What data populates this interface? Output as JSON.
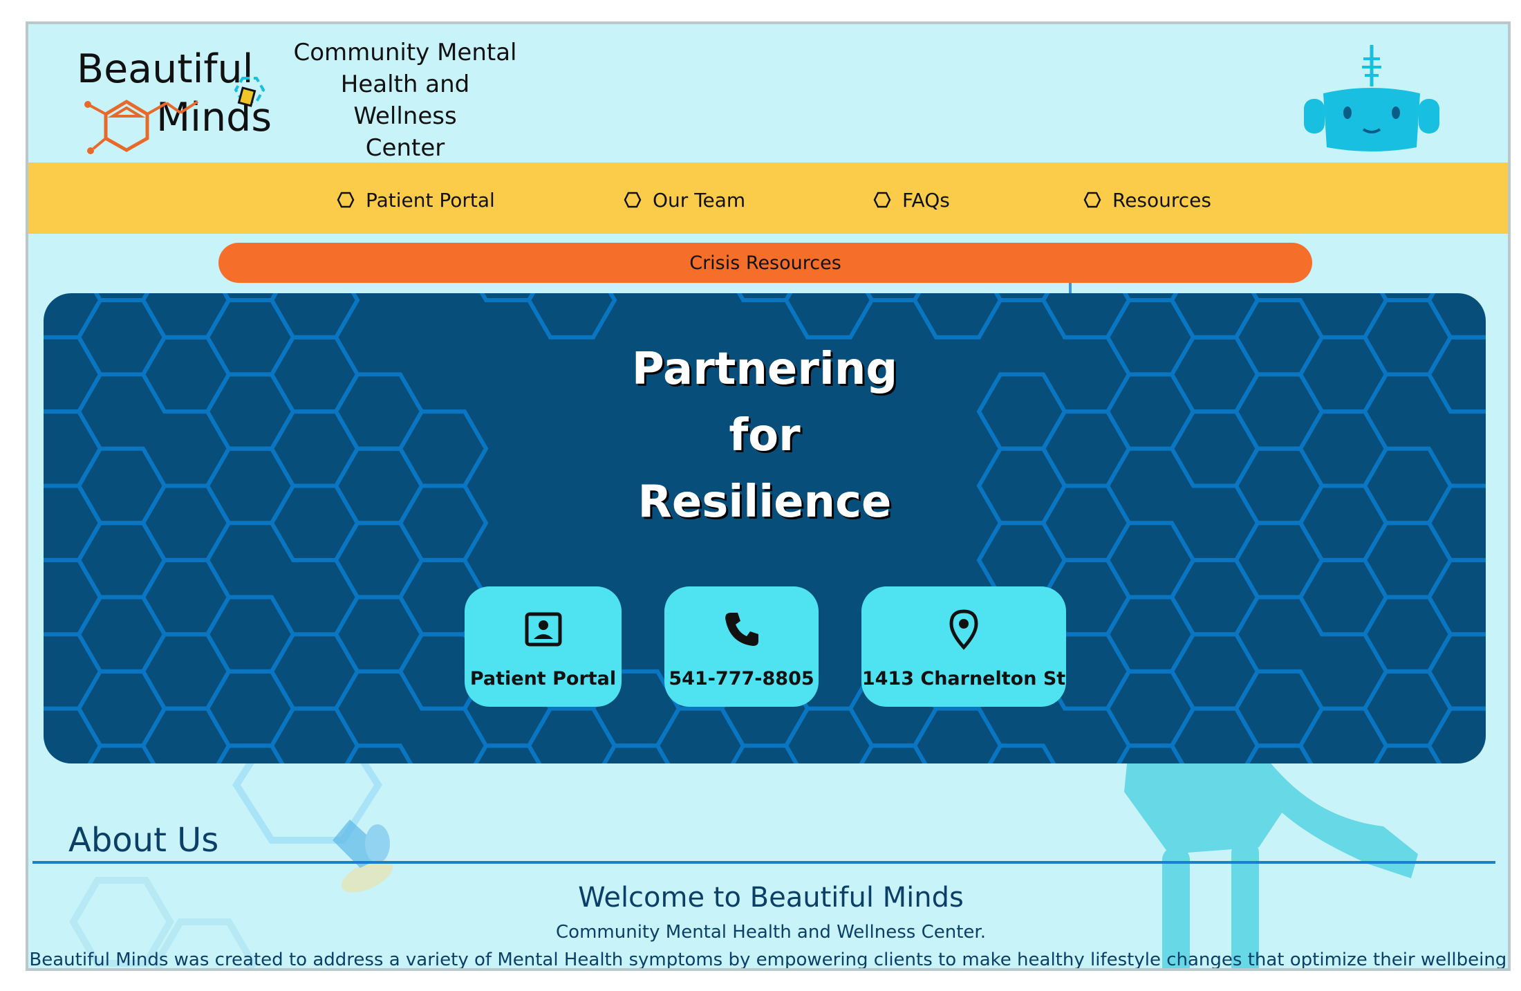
{
  "header": {
    "logo": {
      "word1": "Beautiful",
      "word2": "Minds"
    },
    "tagline": [
      "Community Mental",
      "Health and Wellness",
      "Center"
    ]
  },
  "nav": {
    "items": [
      {
        "label": "Patient Portal",
        "icon": "hexagon-icon"
      },
      {
        "label": "Our Team",
        "icon": "hexagon-icon"
      },
      {
        "label": "FAQs",
        "icon": "hexagon-icon"
      },
      {
        "label": "Resources",
        "icon": "hexagon-icon"
      }
    ]
  },
  "crisis": {
    "label": "Crisis Resources"
  },
  "hero": {
    "title_lines": [
      "Partnering",
      "for",
      "Resilience"
    ],
    "cards": [
      {
        "label": "Patient Portal",
        "icon": "contact-card-icon"
      },
      {
        "label": "541-777-8805",
        "icon": "phone-icon"
      },
      {
        "label": "1413 Charnelton St",
        "icon": "location-pin-icon"
      }
    ]
  },
  "about": {
    "heading": "About Us",
    "welcome": "Welcome to Beautiful Minds",
    "subtitle": "Community Mental Health and Wellness Center.",
    "description": "Beautiful Minds was created to address a variety of Mental Health symptoms by empowering clients to make healthy lifestyle changes that optimize their wellbeing."
  },
  "colors": {
    "page_bg": "#c8f3f9",
    "nav_bg": "#fbcc4a",
    "crisis_bg": "#f56f2b",
    "hero_bg": "#074e7a",
    "hex_stroke": "#0a76c2",
    "card_bg": "#4fe3f1",
    "heading_text": "#0b3f67",
    "logo_orange": "#e8692a",
    "robot": "#18bfe0"
  }
}
